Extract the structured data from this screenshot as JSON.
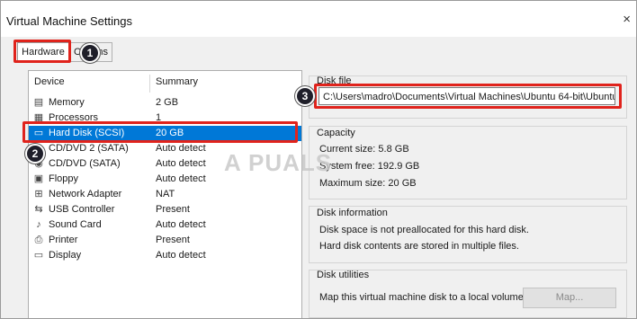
{
  "window": {
    "title": "Virtual Machine Settings",
    "close_glyph": "×"
  },
  "tabs": [
    {
      "label": "Hardware"
    },
    {
      "label": "Options"
    }
  ],
  "device_list": {
    "headers": {
      "device": "Device",
      "summary": "Summary"
    },
    "rows": [
      {
        "icon": "memory-icon",
        "glyph": "▤",
        "name": "Memory",
        "summary": "2 GB"
      },
      {
        "icon": "processor-icon",
        "glyph": "▦",
        "name": "Processors",
        "summary": "1"
      },
      {
        "icon": "hard-disk-icon",
        "glyph": "▭",
        "name": "Hard Disk (SCSI)",
        "summary": "20 GB",
        "selected": true
      },
      {
        "icon": "cd-dvd-icon",
        "glyph": "◉",
        "name": "CD/DVD 2 (SATA)",
        "summary": "Auto detect"
      },
      {
        "icon": "cd-dvd-icon",
        "glyph": "◉",
        "name": "CD/DVD (SATA)",
        "summary": "Auto detect"
      },
      {
        "icon": "floppy-icon",
        "glyph": "▣",
        "name": "Floppy",
        "summary": "Auto detect"
      },
      {
        "icon": "network-adapter-icon",
        "glyph": "⊞",
        "name": "Network Adapter",
        "summary": "NAT"
      },
      {
        "icon": "usb-controller-icon",
        "glyph": "⇆",
        "name": "USB Controller",
        "summary": "Present"
      },
      {
        "icon": "sound-card-icon",
        "glyph": "♪",
        "name": "Sound Card",
        "summary": "Auto detect"
      },
      {
        "icon": "printer-icon",
        "glyph": "⎙",
        "name": "Printer",
        "summary": "Present"
      },
      {
        "icon": "display-icon",
        "glyph": "▭",
        "name": "Display",
        "summary": "Auto detect"
      }
    ]
  },
  "disk_file": {
    "label": "Disk file",
    "value": "C:\\Users\\madro\\Documents\\Virtual Machines\\Ubuntu 64-bit\\Ubuntu"
  },
  "capacity": {
    "label": "Capacity",
    "current": "Current size:  5.8 GB",
    "free": "System free:  192.9 GB",
    "maximum": "Maximum size:  20 GB"
  },
  "disk_information": {
    "label": "Disk information",
    "line1": "Disk space is not preallocated for this hard disk.",
    "line2": "Hard disk contents are stored in multiple files."
  },
  "disk_utilities": {
    "label": "Disk utilities",
    "description": "Map this virtual machine disk to a local volume.",
    "map_button": "Map..."
  },
  "annotations": {
    "badge1": "1",
    "badge2": "2",
    "badge3": "3",
    "accent": "#e0231c"
  },
  "watermark": "A  PUALS"
}
